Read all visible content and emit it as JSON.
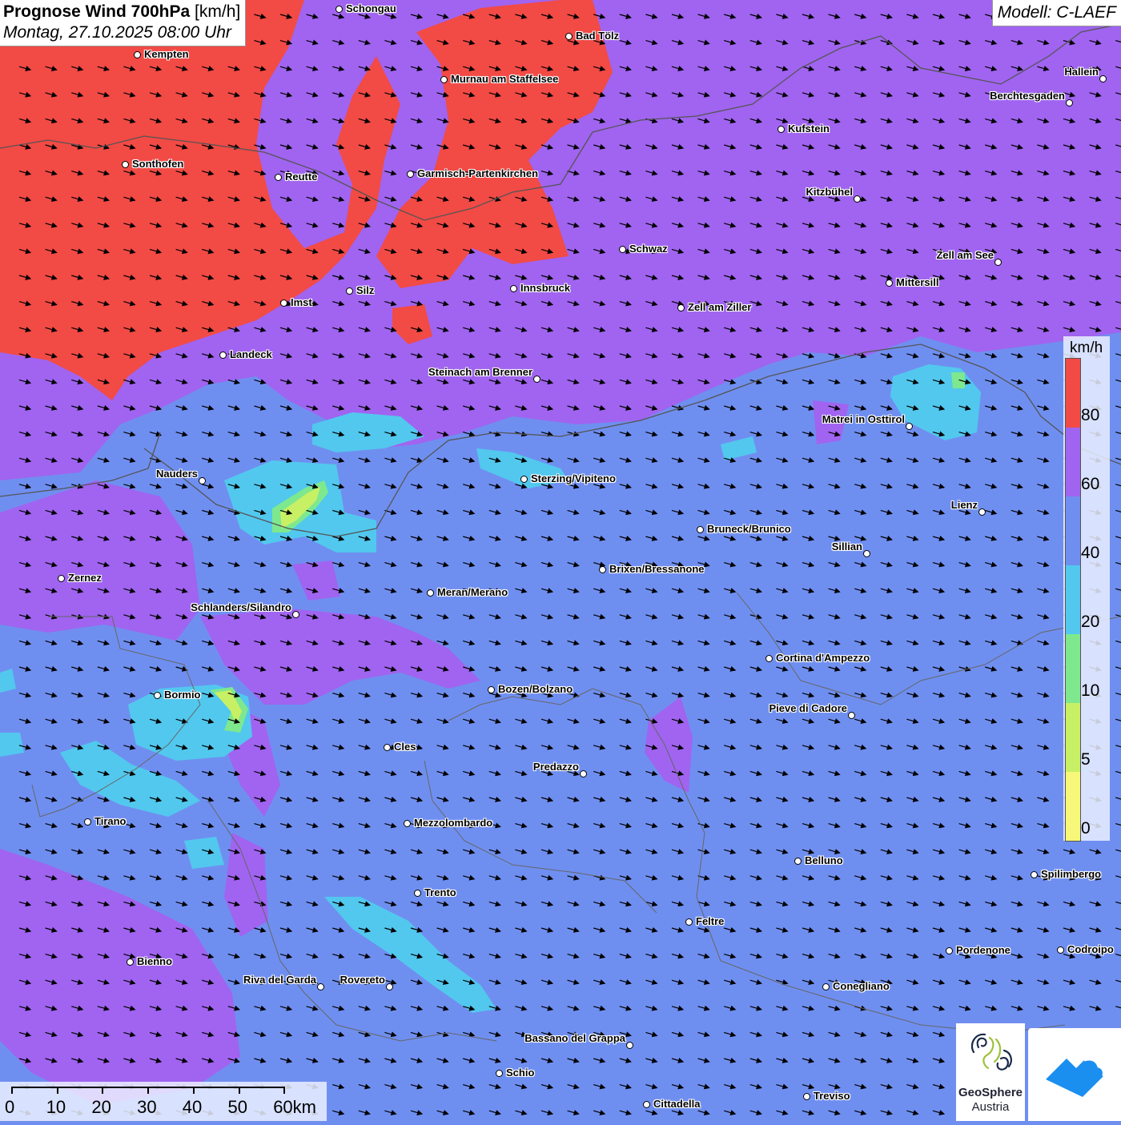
{
  "title": {
    "main": "Prognose Wind 700hPa",
    "unit": "[km/h]",
    "subtitle": "Montag, 27.10.2025 08:00 Uhr"
  },
  "model": "Modell: C-LAEF",
  "legend": {
    "unit": "km/h",
    "labels": [
      "80",
      "60",
      "40",
      "20",
      "10",
      "5",
      "0"
    ],
    "colors": {
      "over80": "#f24a45",
      "60_80": "#a064f0",
      "40_60": "#6f8ff0",
      "20_40": "#52c8ee",
      "10_20": "#7ee88e",
      "5_10": "#c8f064",
      "0_5": "#f7f77a"
    }
  },
  "scalebar": {
    "labels": [
      "0",
      "10",
      "20",
      "30",
      "40",
      "50",
      "60km"
    ]
  },
  "logos": {
    "geosphere_line1": "GeoSphere",
    "geosphere_line2": "Austria"
  },
  "cities": [
    {
      "name": "Schongau"
    },
    {
      "name": "Bad Tölz"
    },
    {
      "name": "Kempten"
    },
    {
      "name": "Murnau am Staffelsee"
    },
    {
      "name": "Hallein"
    },
    {
      "name": "Berchtesgaden"
    },
    {
      "name": "Kufstein"
    },
    {
      "name": "Sonthofen"
    },
    {
      "name": "Reutte"
    },
    {
      "name": "Garmisch-Partenkirchen"
    },
    {
      "name": "Kitzbühel"
    },
    {
      "name": "Schwaz"
    },
    {
      "name": "Zell am See"
    },
    {
      "name": "Mittersill"
    },
    {
      "name": "Silz"
    },
    {
      "name": "Innsbruck"
    },
    {
      "name": "Imst"
    },
    {
      "name": "Zell am Ziller"
    },
    {
      "name": "Landeck"
    },
    {
      "name": "Steinach am Brenner"
    },
    {
      "name": "Matrei in Osttirol"
    },
    {
      "name": "Nauders"
    },
    {
      "name": "Sterzing/Vipiteno"
    },
    {
      "name": "Lienz"
    },
    {
      "name": "Bruneck/Brunico"
    },
    {
      "name": "Sillian"
    },
    {
      "name": "Brixen/Bressanone"
    },
    {
      "name": "Zernez"
    },
    {
      "name": "Meran/Merano"
    },
    {
      "name": "Schlanders/Silandro"
    },
    {
      "name": "Cortina d'Ampezzo"
    },
    {
      "name": "Bozen/Bolzano"
    },
    {
      "name": "Bormio"
    },
    {
      "name": "Pieve di Cadore"
    },
    {
      "name": "Cles"
    },
    {
      "name": "Predazzo"
    },
    {
      "name": "Tirano"
    },
    {
      "name": "Mezzolombardo"
    },
    {
      "name": "Belluno"
    },
    {
      "name": "Spilimbergo"
    },
    {
      "name": "Trento"
    },
    {
      "name": "Feltre"
    },
    {
      "name": "Pordenone"
    },
    {
      "name": "Codroipo"
    },
    {
      "name": "Bienno"
    },
    {
      "name": "Riva del Garda"
    },
    {
      "name": "Rovereto"
    },
    {
      "name": "Conegliano"
    },
    {
      "name": "Bassano del Grappa"
    },
    {
      "name": "Schio"
    },
    {
      "name": "Treviso"
    },
    {
      "name": "Cittadella"
    }
  ]
}
